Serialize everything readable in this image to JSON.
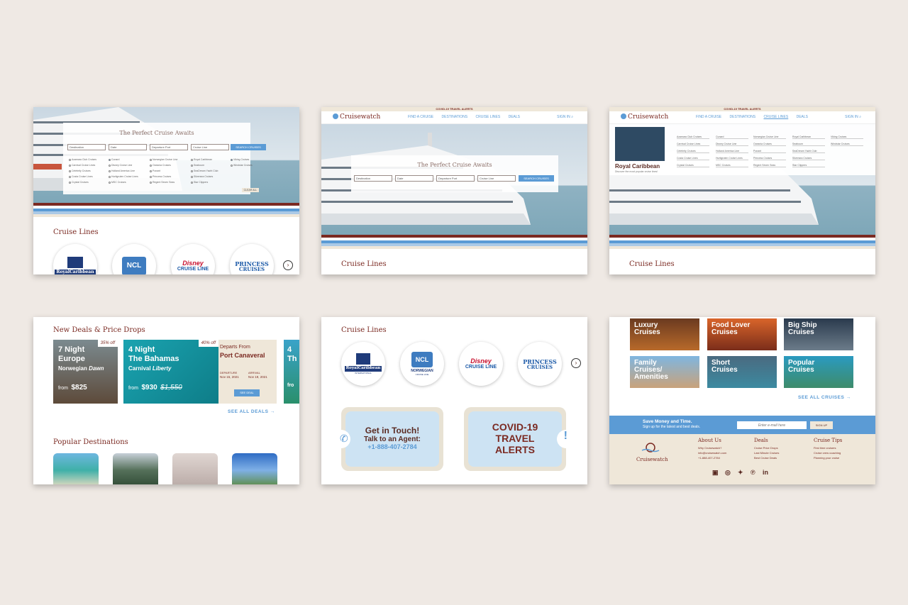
{
  "panel1": {
    "title": "The Perfect Cruise Awaits",
    "selects": [
      "Destination",
      "Date",
      "Departure Port",
      "Cruise Line"
    ],
    "search_label": "SEARCH CRUISES",
    "options": [
      "Azamara Club Cruises",
      "Carnival Cruise Lines",
      "Celebrity Cruises",
      "Costa Cruise Lines",
      "Crystal Cruises",
      "Cunard",
      "Disney Cruise Line",
      "Holland America Line",
      "Hurtigruten Cruise Lines",
      "MSC Cruises",
      "Norwegian Cruise Line",
      "Oceania Cruises",
      "Ponant",
      "Princess Cruises",
      "Regent Seven Seas",
      "Royal Caribbean",
      "Seabourn",
      "SeaDream Yacht Club",
      "Silversea Cruises",
      "Star Clippers",
      "Viking Cruises",
      "Windstar Cruises"
    ],
    "clear_label": "CLEAR ALL",
    "cruise_lines_title": "Cruise Lines"
  },
  "nav": {
    "alert": "COVID-19 TRAVEL ALERTS",
    "brand": "Cruisewatch",
    "links": [
      "FIND A CRUISE",
      "DESTINATIONS",
      "CRUISE LINES",
      "DEALS"
    ],
    "signin": "SIGN IN"
  },
  "panel2": {
    "title": "The Perfect Cruise Awaits",
    "selects": [
      "Destination",
      "Date",
      "Departure Port",
      "Cruise Line"
    ],
    "search_label": "SEARCH CRUISES",
    "cruise_lines_title": "Cruise Lines"
  },
  "panel3": {
    "featured_name": "Royal Caribbean",
    "featured_sub": "Discover the most popular cruise lines!",
    "cruise_lines_title": "Cruise Lines"
  },
  "deals": {
    "title": "New Deals & Price Drops",
    "deal1": {
      "badge": "35% off",
      "line1": "7 Night",
      "line2": "Europe",
      "ship_a": "Norwegian",
      "ship_b": "Dawn",
      "from": "from",
      "price": "$825"
    },
    "deal2": {
      "badge": "40% off",
      "line1": "4 Night",
      "line2": "The Bahamas",
      "ship_a": "Carnival",
      "ship_b": "Liberty",
      "from": "from",
      "price": "$930",
      "old_price": "$1,550"
    },
    "detail": {
      "departs": "Departs From",
      "port": "Port Canaveral",
      "dep_label": "DEPARTURE",
      "dep_date": "Nov 15, 2021",
      "arr_label": "ARRIVAL",
      "arr_date": "Nov 19, 2021",
      "button": "SEE DEAL"
    },
    "peek": [
      "4",
      "Th",
      "fro"
    ],
    "see_all": "SEE ALL DEALS",
    "popular_title": "Popular Destinations"
  },
  "panel5": {
    "cruise_lines_title": "Cruise Lines",
    "logos": [
      {
        "name": "RoyalCaribbean",
        "sub": "INTERNATIONAL"
      },
      {
        "name": "NCL",
        "sub": "NORWEGIAN",
        "sub2": "CRUISE LINE"
      },
      {
        "name": "Disney",
        "sub": "CRUISE LINE"
      },
      {
        "name": "PRINCESS",
        "sub": "CRUISES"
      }
    ],
    "contact_title": "Get in Touch!",
    "contact_sub": "Talk to an Agent:",
    "phone": "+1-888-407-2784",
    "covid": [
      "COVID-19",
      "TRAVEL",
      "ALERTS"
    ]
  },
  "panel6": {
    "categories": [
      {
        "label1": "Luxury",
        "label2": "Cruises"
      },
      {
        "label1": "Food Lover",
        "label2": "Cruises"
      },
      {
        "label1": "Big Ship",
        "label2": "Cruises"
      },
      {
        "label1": "Family",
        "label2": "Cruises/",
        "label3": "Amenities"
      },
      {
        "label1": "Short",
        "label2": "Cruises"
      },
      {
        "label1": "Popular",
        "label2": "Cruises"
      }
    ],
    "see_all": "SEE ALL CRUISES",
    "newsletter_title": "Save Money and Time.",
    "newsletter_sub": "Sign up for the latest and best deals.",
    "email_placeholder": "Enter e-mail here",
    "signup": "SIGN UP",
    "brand": "Cruisewatch",
    "about": {
      "title": "About Us",
      "items": [
        "Why Cruisewatch?",
        "info@cruisewatch.com",
        "+1-888-407-2784"
      ]
    },
    "deals": {
      "title": "Deals",
      "items": [
        "Cruise Price Drops",
        "Last Minute Cruises",
        "Best Cruise Deals"
      ]
    },
    "tips": {
      "title": "Cruise Tips",
      "items": [
        "First time cruisers",
        "Cruise crew coaching",
        "Planning your cruise"
      ]
    }
  },
  "colors": {
    "accent": "#5b9bd5",
    "brand": "#7b2a22",
    "cream": "#efe7d9",
    "background": "#efe9e4"
  }
}
